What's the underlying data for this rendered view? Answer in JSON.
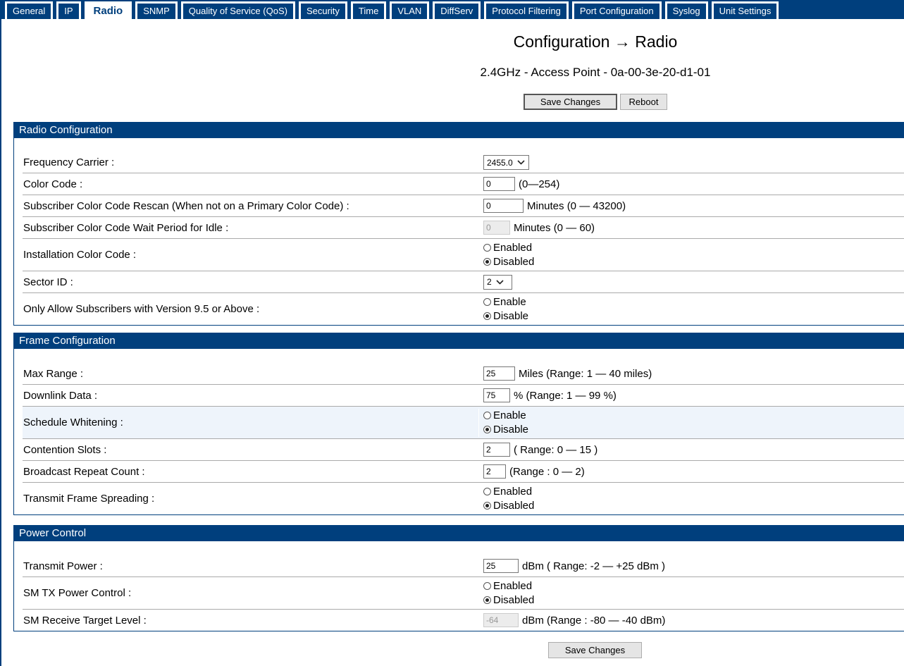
{
  "tabs": [
    "General",
    "IP",
    "Radio",
    "SNMP",
    "Quality of Service (QoS)",
    "Security",
    "Time",
    "VLAN",
    "DiffServ",
    "Protocol Filtering",
    "Port Configuration",
    "Syslog",
    "Unit Settings"
  ],
  "active_tab": "Radio",
  "title": "Configuration → Radio",
  "subtitle": "2.4GHz - Access Point - 0a-00-3e-20-d1-01",
  "buttons": {
    "save": "Save Changes",
    "reboot": "Reboot"
  },
  "sections": [
    {
      "title": "Radio Configuration",
      "rows": [
        {
          "label": "Frequency Carrier :",
          "type": "select",
          "value": "2455.0"
        },
        {
          "label": "Color Code :",
          "type": "input",
          "value": "0",
          "suffix": "(0—254)"
        },
        {
          "label": "Subscriber Color Code Rescan (When not on a Primary Color Code) :",
          "type": "input",
          "value": "0",
          "suffix": "Minutes (0 — 43200)"
        },
        {
          "label": "Subscriber Color Code Wait Period for Idle :",
          "type": "input",
          "value": "0",
          "disabled": true,
          "suffix": "Minutes (0 — 60)"
        },
        {
          "label": "Installation Color Code :",
          "type": "radio",
          "options": [
            "Enabled",
            "Disabled"
          ],
          "selected": "Disabled"
        },
        {
          "label": "Sector ID :",
          "type": "select",
          "value": "2"
        },
        {
          "label": "Only Allow Subscribers with Version 9.5 or Above :",
          "type": "radio",
          "options": [
            "Enable",
            "Disable"
          ],
          "selected": "Disable"
        }
      ]
    },
    {
      "title": "Frame Configuration",
      "rows": [
        {
          "label": "Max Range :",
          "type": "input",
          "value": "25",
          "suffix": "Miles (Range: 1 — 40 miles)"
        },
        {
          "label": "Downlink Data :",
          "type": "input",
          "value": "75",
          "suffix": "% (Range: 1 — 99 %)"
        },
        {
          "label": "Schedule Whitening :",
          "type": "radio",
          "options": [
            "Enable",
            "Disable"
          ],
          "selected": "Disable",
          "highlight": true
        },
        {
          "label": "Contention Slots :",
          "type": "input",
          "value": "2",
          "suffix": "( Range: 0 — 15 )"
        },
        {
          "label": "Broadcast Repeat Count :",
          "type": "input",
          "value": "2",
          "suffix": "(Range : 0 — 2)"
        },
        {
          "label": "Transmit Frame Spreading :",
          "type": "radio",
          "options": [
            "Enabled",
            "Disabled"
          ],
          "selected": "Disabled"
        }
      ]
    },
    {
      "title": "Power Control",
      "rows": [
        {
          "label": "Transmit Power :",
          "type": "input",
          "value": "25",
          "suffix": "dBm ( Range: -2 — +25 dBm )"
        },
        {
          "label": "SM TX Power Control :",
          "type": "radio",
          "options": [
            "Enabled",
            "Disabled"
          ],
          "selected": "Disabled"
        },
        {
          "label": "SM Receive Target Level :",
          "type": "input",
          "value": "-64",
          "disabled": true,
          "suffix": "dBm (Range : -80 — -40 dBm)"
        }
      ]
    }
  ]
}
